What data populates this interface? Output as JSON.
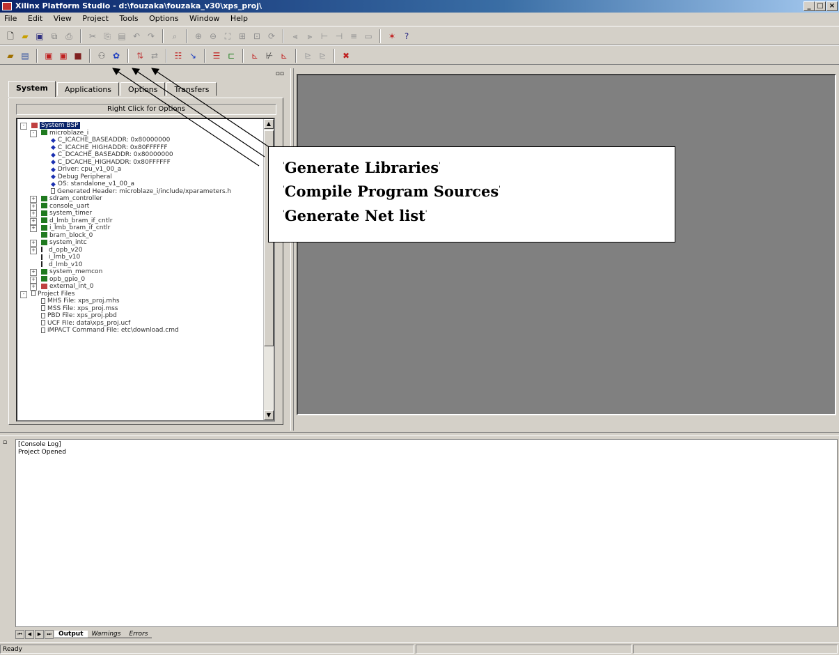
{
  "window": {
    "title": "Xilinx Platform Studio - d:\\fouzaka\\fouzaka_v30\\xps_proj\\",
    "minimize": "_",
    "maximize": "□",
    "close": "×"
  },
  "menu": [
    "File",
    "Edit",
    "View",
    "Project",
    "Tools",
    "Options",
    "Window",
    "Help"
  ],
  "left_panel": {
    "tabs": [
      "System",
      "Applications",
      "Options",
      "Transfers"
    ],
    "right_click_hint": "Right Click for Options",
    "tree": [
      {
        "label": "System BSP",
        "level": 0,
        "icon": "proj",
        "exp": "-",
        "selected": true
      },
      {
        "label": "microblaze_i",
        "level": 1,
        "icon": "green",
        "exp": "-"
      },
      {
        "label": "C_ICACHE_BASEADDR: 0x80000000",
        "level": 2,
        "icon": "blue"
      },
      {
        "label": "C_ICACHE_HIGHADDR: 0x80FFFFFF",
        "level": 2,
        "icon": "blue"
      },
      {
        "label": "C_DCACHE_BASEADDR: 0x80000000",
        "level": 2,
        "icon": "blue"
      },
      {
        "label": "C_DCACHE_HIGHADDR: 0x80FFFFFF",
        "level": 2,
        "icon": "blue"
      },
      {
        "label": "Driver: cpu_v1_00_a",
        "level": 2,
        "icon": "blue"
      },
      {
        "label": "Debug Peripheral",
        "level": 2,
        "icon": "blue"
      },
      {
        "label": "OS: standalone_v1_00_a",
        "level": 2,
        "icon": "blue"
      },
      {
        "label": "Generated Header: microblaze_i/include/xparameters.h",
        "level": 2,
        "icon": "doc"
      },
      {
        "label": "sdram_controller",
        "level": 1,
        "icon": "green",
        "exp": "+"
      },
      {
        "label": "console_uart",
        "level": 1,
        "icon": "green",
        "exp": "+"
      },
      {
        "label": "system_timer",
        "level": 1,
        "icon": "green",
        "exp": "+"
      },
      {
        "label": "d_lmb_bram_if_cntlr",
        "level": 1,
        "icon": "green",
        "exp": "+"
      },
      {
        "label": "i_lmb_bram_if_cntlr",
        "level": 1,
        "icon": "green",
        "exp": "+"
      },
      {
        "label": "bram_block_0",
        "level": 1,
        "icon": "green"
      },
      {
        "label": "system_intc",
        "level": 1,
        "icon": "green",
        "exp": "+"
      },
      {
        "label": "d_opb_v20",
        "level": 1,
        "icon": "bus",
        "exp": "+"
      },
      {
        "label": "i_lmb_v10",
        "level": 1,
        "icon": "bus"
      },
      {
        "label": "d_lmb_v10",
        "level": 1,
        "icon": "bus"
      },
      {
        "label": "system_memcon",
        "level": 1,
        "icon": "green",
        "exp": "+"
      },
      {
        "label": "opb_gpio_0",
        "level": 1,
        "icon": "green",
        "exp": "+"
      },
      {
        "label": "external_int_0",
        "level": 1,
        "icon": "proj",
        "exp": "+"
      },
      {
        "label": "Project Files",
        "level": 0,
        "icon": "doc",
        "exp": "-"
      },
      {
        "label": "MHS File: xps_proj.mhs",
        "level": 1,
        "icon": "doc"
      },
      {
        "label": "MSS File: xps_proj.mss",
        "level": 1,
        "icon": "doc"
      },
      {
        "label": "PBD File: xps_proj.pbd",
        "level": 1,
        "icon": "doc"
      },
      {
        "label": "UCF File: data\\xps_proj.ucf",
        "level": 1,
        "icon": "doc"
      },
      {
        "label": "iMPACT Command File: etc\\download.cmd",
        "level": 1,
        "icon": "doc"
      }
    ]
  },
  "console": {
    "title": "[Console Log]",
    "lines": [
      "Project Opened"
    ],
    "tabs": [
      "Output",
      "Warnings",
      "Errors"
    ]
  },
  "status": {
    "text": "Ready"
  },
  "callout": {
    "lines": [
      "Generate Libraries",
      "Compile Program Sources",
      "Generate Net list"
    ]
  },
  "icons": {
    "toolbar1": [
      "new-file-icon",
      "open-icon",
      "save-icon",
      "save-all-icon",
      "print-icon",
      "cut-icon",
      "copy-icon",
      "paste-icon",
      "undo-icon",
      "redo-icon",
      "find-icon",
      "zoom-in-icon",
      "zoom-out-icon",
      "zoom-fit-icon",
      "zoom-area-icon",
      "zoom-select-icon",
      "refresh-icon",
      "align-left-icon",
      "align-right-icon",
      "connect-icon",
      "disconnect-icon",
      "bus-icon",
      "port-icon",
      "acrobat-icon",
      "help-icon"
    ],
    "toolbar2": [
      "add-core-icon",
      "project-options-icon",
      "generate-addr-icon",
      "generate-bsp-icon",
      "generate-bit-icon",
      "generate-libraries-icon",
      "compile-sources-icon",
      "generate-netlist-icon",
      "update-bitstream-icon",
      "download-icon",
      "impact-icon",
      "sim-model-icon",
      "sim-compile-icon",
      "xmd-icon",
      "debugger-icon",
      "platgen-icon",
      "libgen-icon",
      "clean-icon",
      "stop-icon"
    ]
  }
}
